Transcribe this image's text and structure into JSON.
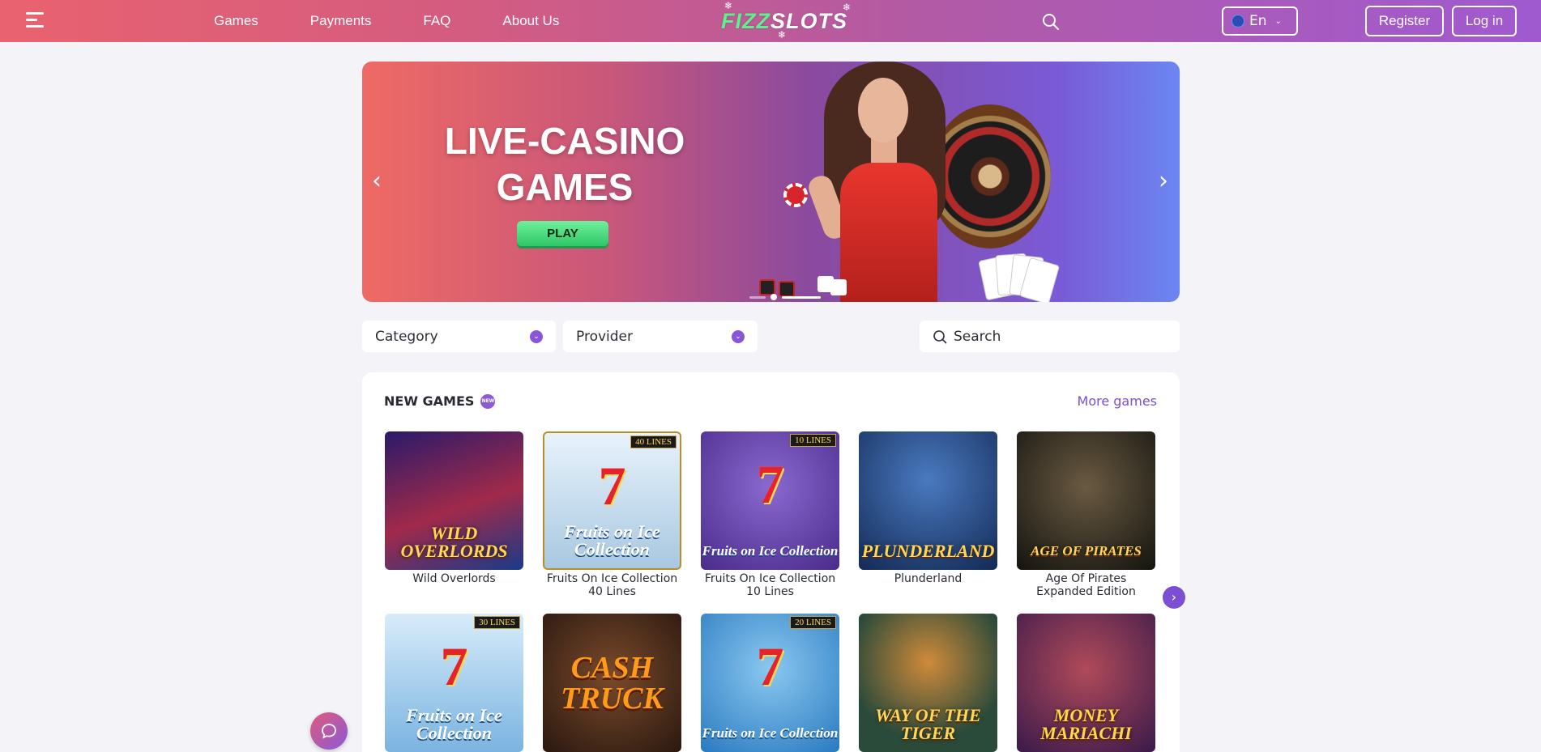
{
  "header": {
    "nav": [
      "Games",
      "Payments",
      "FAQ",
      "About Us"
    ],
    "logo_text_1": "FIZZ",
    "logo_text_2": "SLOTS",
    "language": "En",
    "register": "Register",
    "login": "Log in"
  },
  "banner": {
    "title": "LIVE-CASINO GAMES",
    "play": "PLAY"
  },
  "filters": {
    "category": "Category",
    "provider": "Provider",
    "search_placeholder": "Search"
  },
  "section": {
    "title": "NEW GAMES",
    "badge": "NEW",
    "more": "More games"
  },
  "games_row1": [
    {
      "name": "Wild Overlords",
      "thumb_text": "WILD OVERLORDS",
      "bg": "#3a1a5a"
    },
    {
      "name": "Fruits On Ice Collection 40 Lines",
      "thumb_text": "Fruits on Ice Collection",
      "bg": "#c7dbea",
      "lines": "40 LINES"
    },
    {
      "name": "Fruits On Ice Collection 10 Lines",
      "thumb_text": "Fruits on Ice Collection",
      "bg": "#5a3a9a",
      "lines": "10 LINES"
    },
    {
      "name": "Plunderland",
      "thumb_text": "PLUNDERLAND",
      "bg": "#1d3a6a"
    },
    {
      "name": "Age Of Pirates Expanded Edition",
      "thumb_text": "AGE OF PIRATES",
      "bg": "#2a2a22"
    }
  ],
  "games_row2": [
    {
      "thumb_text": "Fruits on Ice Collection",
      "bg": "#8ac0e6",
      "lines": "30 LINES"
    },
    {
      "thumb_text": "CASH TRUCK",
      "bg": "#3a2418"
    },
    {
      "thumb_text": "Fruits on Ice Collection",
      "bg": "#4aa0da",
      "lines": "20 LINES"
    },
    {
      "thumb_text": "WAY OF THE TIGER",
      "bg": "#2a4a3a"
    },
    {
      "thumb_text": "MONEY MARIACHI",
      "bg": "#5a2a5a"
    }
  ]
}
